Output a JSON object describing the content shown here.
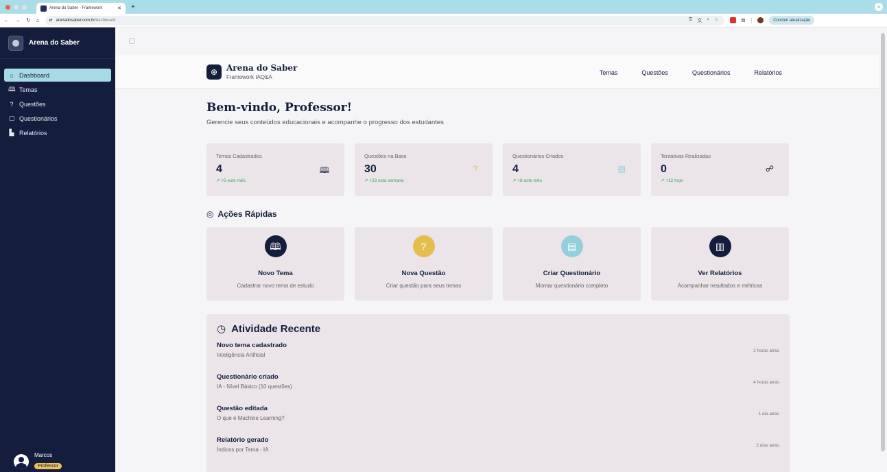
{
  "browser": {
    "tab_title": "Arena do Saber - Framework",
    "tab_close": "✕",
    "new_tab": "+",
    "url_host": "arenadosaber.com.br",
    "url_path": "/dashboard",
    "update_button": "Concluir atualização"
  },
  "sidebar": {
    "brand": "Arena do Saber",
    "items": [
      {
        "label": "Dashboard",
        "icon": "home-icon",
        "glyph": "⌂"
      },
      {
        "label": "Temas",
        "icon": "book-icon",
        "glyph": "🕮"
      },
      {
        "label": "Questões",
        "icon": "question-icon",
        "glyph": "?"
      },
      {
        "label": "Questionários",
        "icon": "clipboard-icon",
        "glyph": "▢"
      },
      {
        "label": "Relatórios",
        "icon": "bar-chart-icon",
        "glyph": "▙"
      }
    ],
    "user": {
      "name": "Marcos",
      "role": "Professor"
    }
  },
  "header": {
    "logo_glyph": "⊕",
    "title": "Arena do Saber",
    "subtitle": "Framework IAQ&A",
    "nav": [
      "Temas",
      "Questões",
      "Questionários",
      "Relatórios"
    ]
  },
  "welcome": {
    "title": "Bem-vindo, Professor!",
    "subtitle": "Gerencie seus conteúdos educacionais e acompanhe o progresso dos estudantes"
  },
  "stats": [
    {
      "label": "Temas Cadastrados",
      "value": "4",
      "trend": "↗ +5 este mês",
      "icon": "book-icon",
      "glyph": "🕮"
    },
    {
      "label": "Questões na Base",
      "value": "30",
      "trend": "↗ +23 esta semana",
      "icon": "question-icon",
      "glyph": "?"
    },
    {
      "label": "Questionários Criados",
      "value": "4",
      "trend": "↗ +8 este mês",
      "icon": "clipboard-icon",
      "glyph": "▤"
    },
    {
      "label": "Tentativas Realizadas",
      "value": "0",
      "trend": "↗ +12 hoje",
      "icon": "users-icon",
      "glyph": "☍"
    }
  ],
  "quick_actions": {
    "title": "Ações Rápidas",
    "items": [
      {
        "title": "Novo Tema",
        "subtitle": "Cadastrar novo tema de estudo",
        "icon": "book-icon",
        "glyph": "🕮",
        "color": "#141e3c"
      },
      {
        "title": "Nova Questão",
        "subtitle": "Criar questão para seus temas",
        "icon": "question-icon",
        "glyph": "?",
        "color": "#e4bd4f"
      },
      {
        "title": "Criar Questionário",
        "subtitle": "Montar questionário completo",
        "icon": "clipboard-icon",
        "glyph": "▤",
        "color": "#93d0dc"
      },
      {
        "title": "Ver Relatórios",
        "subtitle": "Acompanhar resultados e métricas",
        "icon": "bar-chart-icon",
        "glyph": "▥",
        "color": "#141e3c"
      }
    ]
  },
  "activity": {
    "title": "Atividade Recente",
    "items": [
      {
        "title": "Novo tema cadastrado",
        "subtitle": "Inteligência Artificial",
        "time": "2 horas atrás"
      },
      {
        "title": "Questionário criado",
        "subtitle": "IA - Nível Básico (10 questões)",
        "time": "4 horas atrás"
      },
      {
        "title": "Questão editada",
        "subtitle": "O que é Machine Learning?",
        "time": "1 dia atrás"
      },
      {
        "title": "Relatório gerado",
        "subtitle": "Índices por Tema - IA",
        "time": "2 dias atrás"
      }
    ]
  }
}
